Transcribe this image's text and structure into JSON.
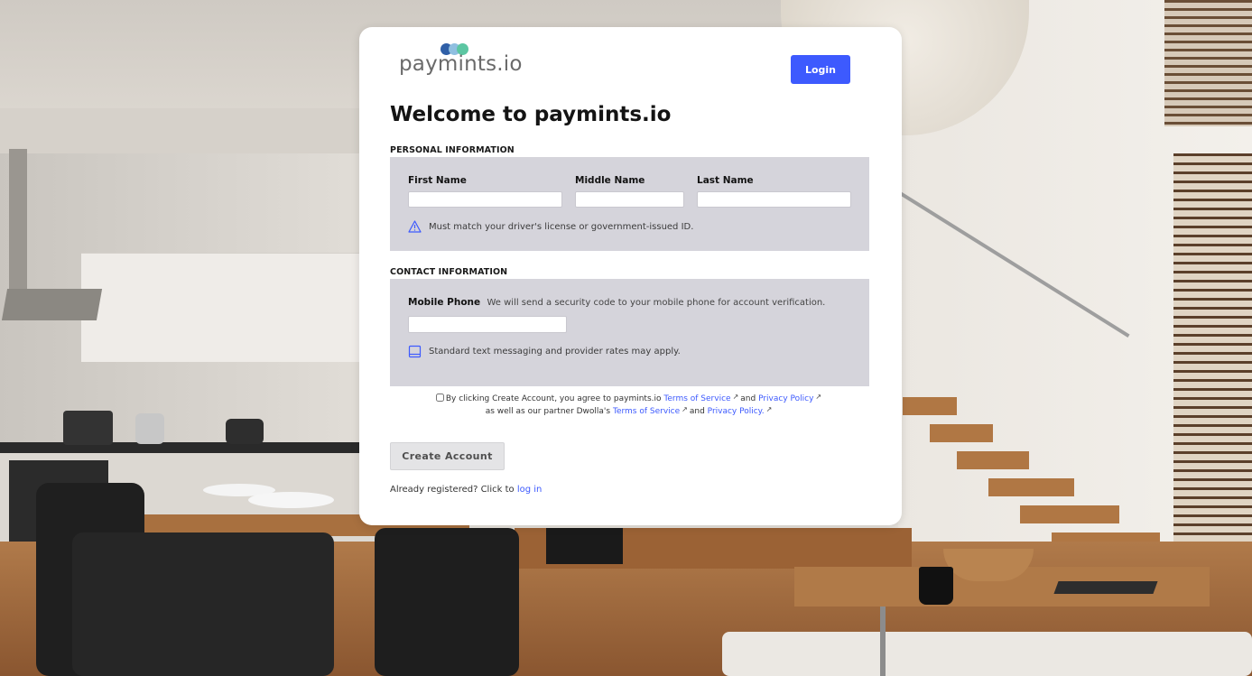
{
  "brand": {
    "logo_text": "paymints.io",
    "accent_color": "#3d5afe",
    "logo_dot_colors": [
      "#2f5fa7",
      "#8fbfe0",
      "#5cc6a2"
    ]
  },
  "header": {
    "login_label": "Login",
    "title": "Welcome to paymints.io"
  },
  "personal": {
    "section_label": "PERSONAL INFORMATION",
    "first_name_label": "First Name",
    "middle_name_label": "Middle Name",
    "last_name_label": "Last Name",
    "first_name_value": "",
    "middle_name_value": "",
    "last_name_value": "",
    "note": "Must match your driver's license or government-issued ID.",
    "note_icon": "warning-triangle-icon"
  },
  "contact": {
    "section_label": "CONTACT INFORMATION",
    "mobile_label": "Mobile Phone",
    "mobile_desc": "We will send a security code to your mobile phone for account verification.",
    "mobile_value": "",
    "note": "Standard text messaging and provider rates may apply.",
    "note_icon": "mobile-device-icon"
  },
  "consent": {
    "checked": false,
    "text_1": "By clicking Create Account, you agree to paymints.io",
    "tos_1": "Terms of Service",
    "and_1": "and",
    "privacy_1": "Privacy Policy",
    "text_2": "as well as our partner Dwolla's",
    "tos_2": "Terms of Service",
    "and_2": "and",
    "privacy_2": "Privacy Policy."
  },
  "actions": {
    "create_label": "Create Account",
    "already_text": "Already registered? Click to",
    "login_link": "log in"
  }
}
